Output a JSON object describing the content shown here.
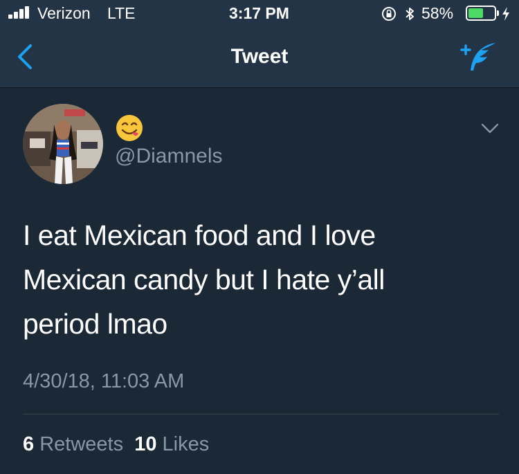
{
  "status_bar": {
    "carrier": "Verizon",
    "network": "LTE",
    "time": "3:17 PM",
    "battery_percent": "58%",
    "battery_level": 0.58,
    "signal_bars": 4
  },
  "nav": {
    "title": "Tweet",
    "back_icon": "chevron-left-icon",
    "compose_icon": "compose-tweet-icon",
    "accent_color": "#1da1f2"
  },
  "tweet": {
    "display_name_emoji": "😋",
    "handle": "@Diamnels",
    "text_lines": [
      "I eat Mexican food and I love",
      "Mexican candy but I hate y’all",
      "period lmao"
    ],
    "timestamp": "4/30/18, 11:03 AM",
    "retweets_count": "6",
    "retweets_label": "Retweets",
    "likes_count": "10",
    "likes_label": "Likes"
  },
  "colors": {
    "background": "#1b2836",
    "bar": "#243447",
    "secondary_text": "#8899a6",
    "battery_green": "#4cd964"
  }
}
